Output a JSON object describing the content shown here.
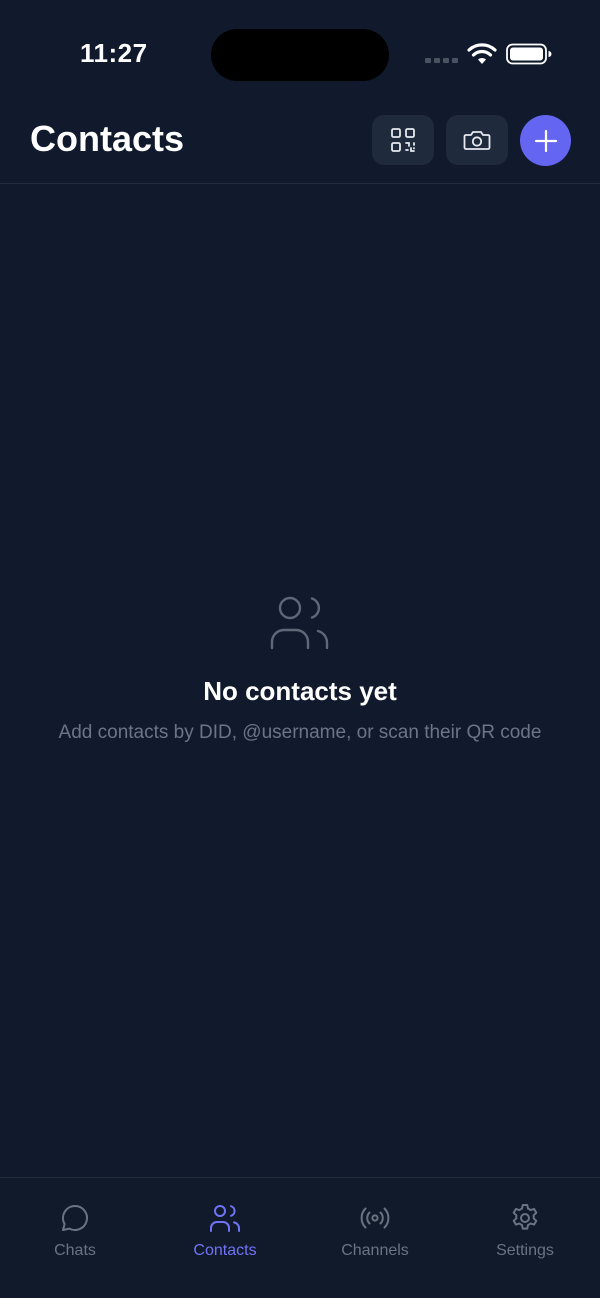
{
  "status_bar": {
    "time": "11:27"
  },
  "header": {
    "title": "Contacts",
    "buttons": [
      {
        "name": "qr-code",
        "icon": "qr-code-icon"
      },
      {
        "name": "camera",
        "icon": "camera-icon"
      },
      {
        "name": "add",
        "icon": "plus-icon"
      }
    ]
  },
  "empty_state": {
    "icon": "users-icon",
    "title": "No contacts yet",
    "subtitle": "Add contacts by DID, @username, or scan their QR code"
  },
  "tabs": [
    {
      "label": "Chats",
      "icon": "chat-bubble-icon",
      "active": false
    },
    {
      "label": "Contacts",
      "icon": "users-icon",
      "active": true
    },
    {
      "label": "Channels",
      "icon": "broadcast-icon",
      "active": false
    },
    {
      "label": "Settings",
      "icon": "gear-icon",
      "active": false
    }
  ],
  "colors": {
    "background": "#101a2c",
    "accent": "#6466f1",
    "button_bg": "#1f2a3c",
    "muted_text": "#6c7585",
    "active_tab": "#7173f5"
  }
}
